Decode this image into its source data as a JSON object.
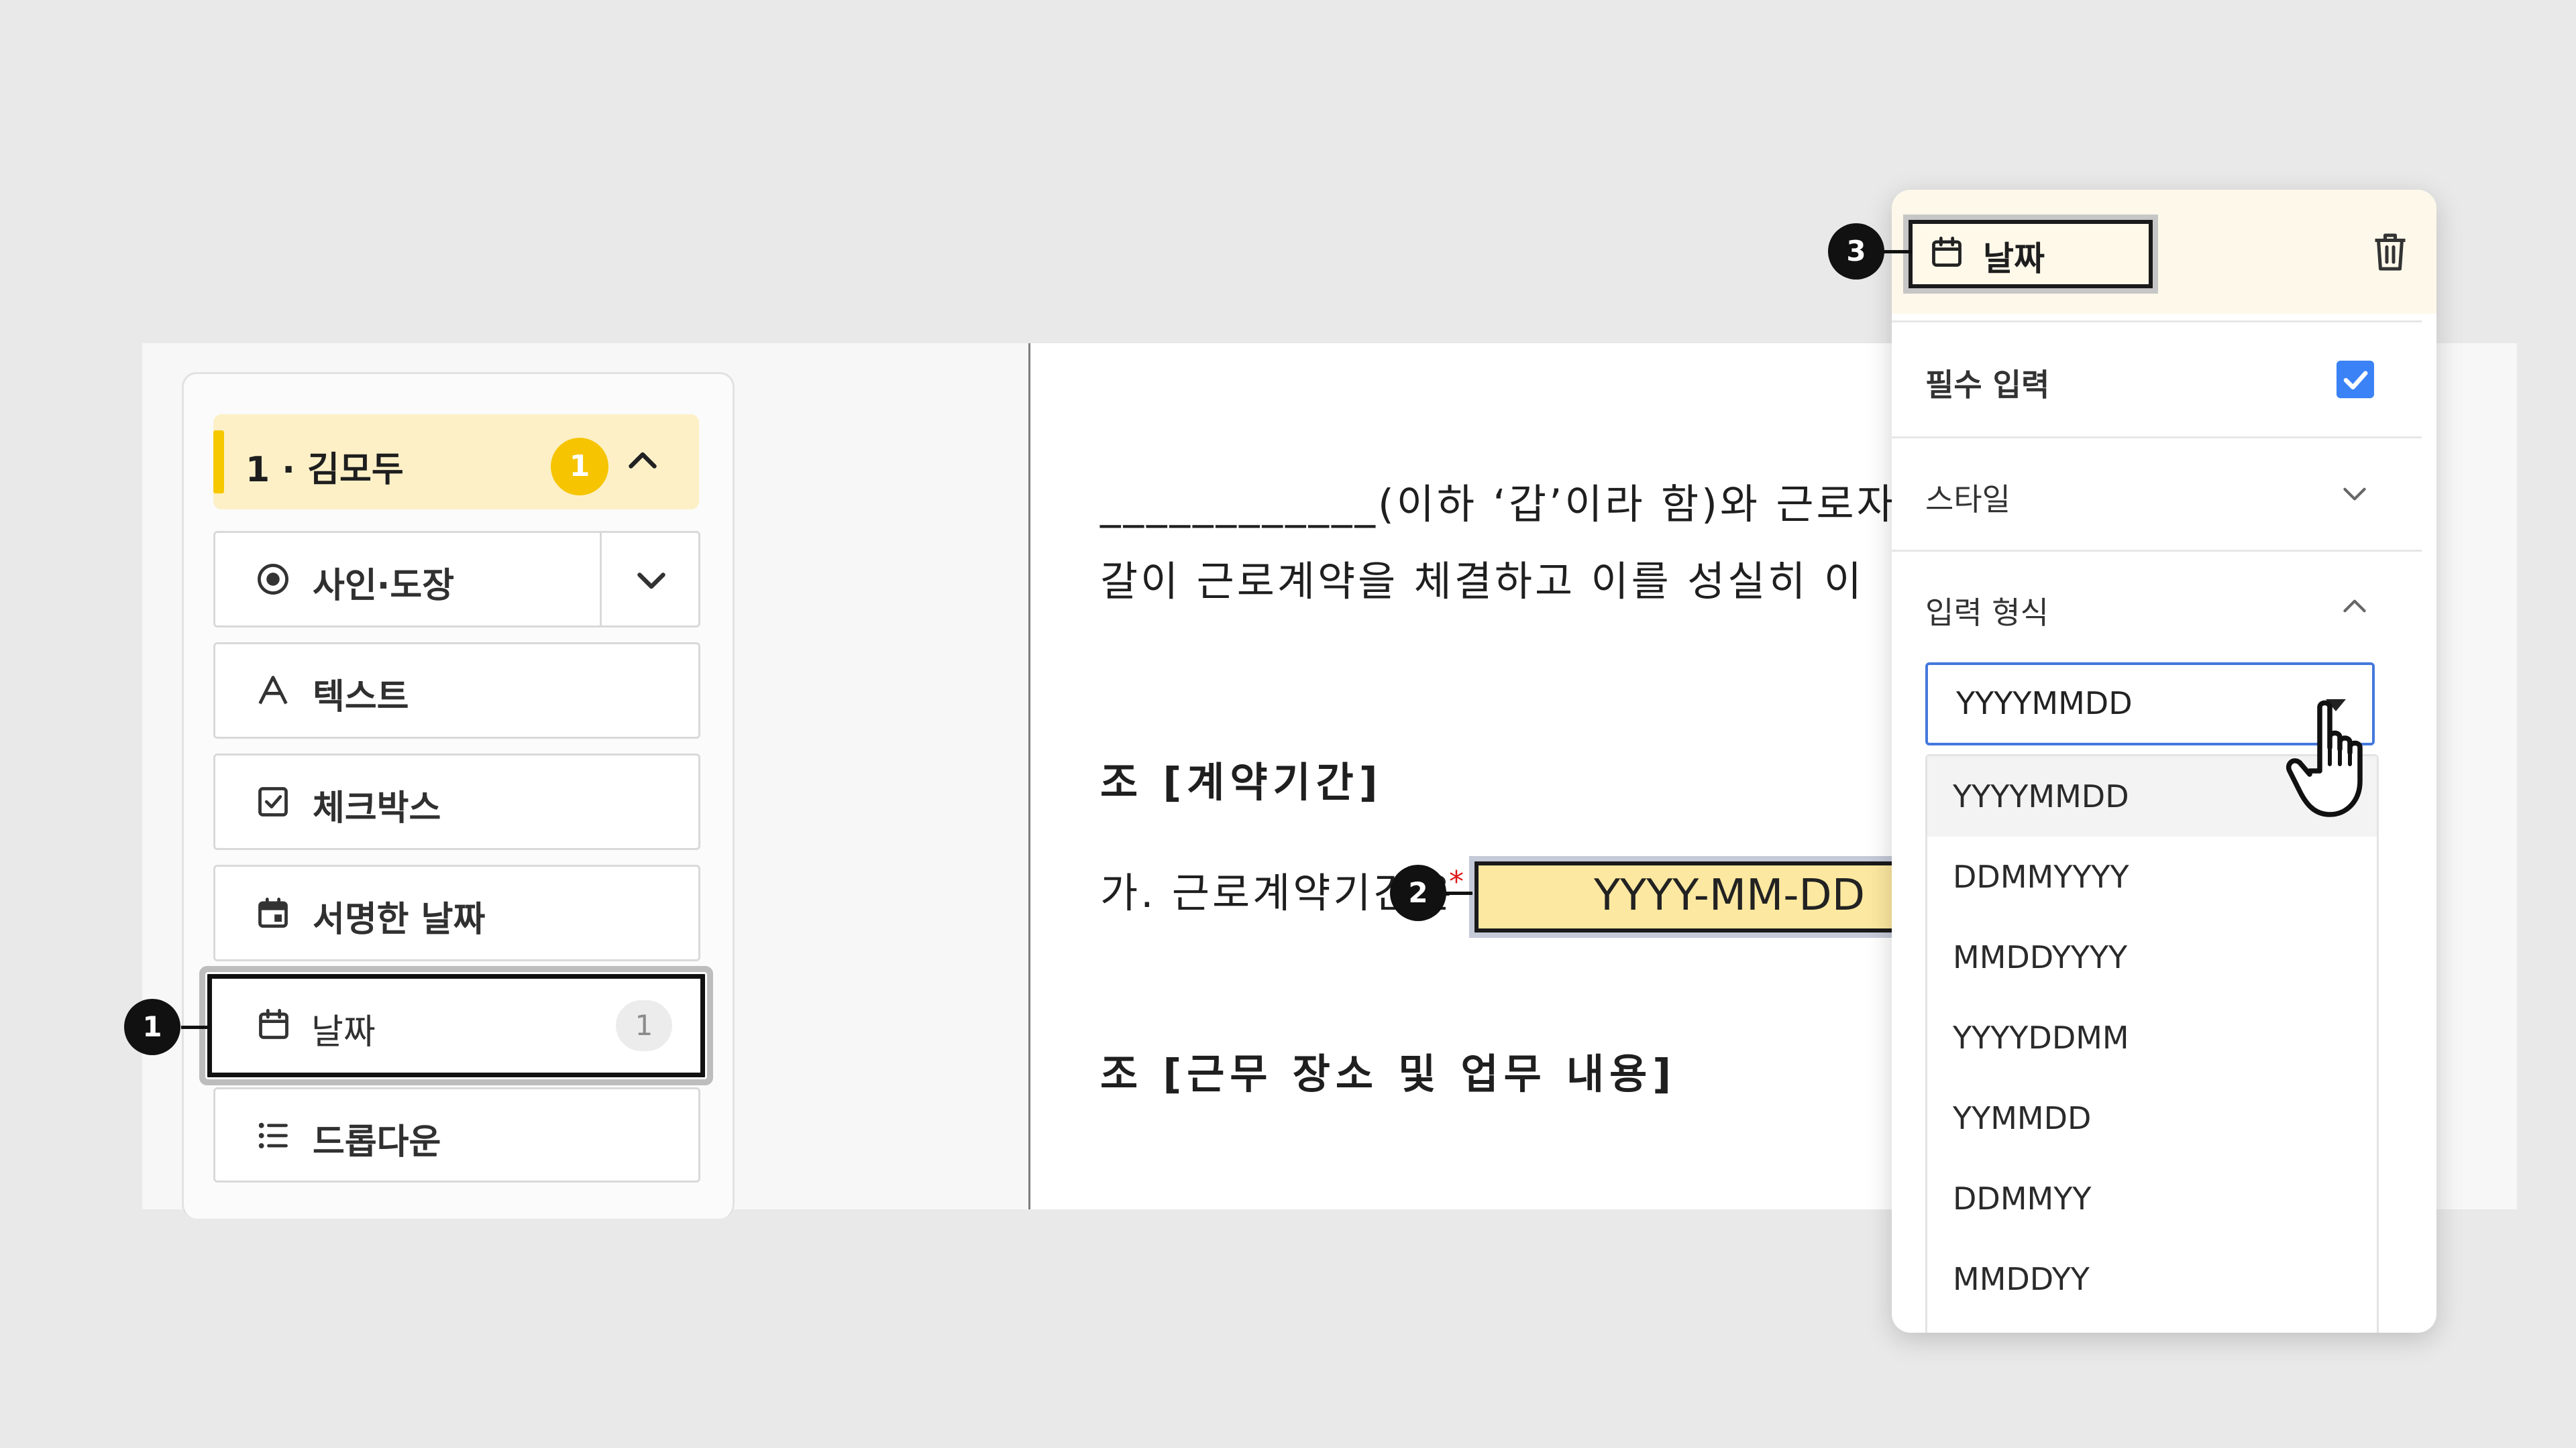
{
  "sidebar": {
    "signer": {
      "name": "1 · 김모두",
      "badge": "1"
    },
    "items": [
      {
        "label": "사인·도장",
        "icon": "radio-target-icon"
      },
      {
        "label": "텍스트",
        "icon": "text-a-icon"
      },
      {
        "label": "체크박스",
        "icon": "checkbox-icon"
      },
      {
        "label": "서명한 날짜",
        "icon": "calendar-filled-icon"
      },
      {
        "label": "날짜",
        "icon": "calendar-icon",
        "count": "1"
      },
      {
        "label": "드롭다운",
        "icon": "list-icon"
      }
    ]
  },
  "document": {
    "lines": [
      "____________(이하 ‘갑’이라 함)와 근로자",
      "갈이 근로계약을 체결하고 이를 성실히 이",
      "조 [계약기간]",
      "가. 근로계약기간은",
      "조 [근무 장소 및 업무 내용]"
    ],
    "date_field_placeholder": "YYYY-MM-DD",
    "required_mark": "*"
  },
  "callouts": [
    "1",
    "2",
    "3"
  ],
  "panel": {
    "field_type": "날짜",
    "required_label": "필수 입력",
    "required_checked": true,
    "style_label": "스타일",
    "format_label": "입력 형식",
    "selected_format": "YYYYMMDD",
    "format_options": [
      "YYYYMMDD",
      "DDMMYYYY",
      "MMDDYYYY",
      "YYYYDDMM",
      "YYMMDD",
      "DDMMYY",
      "MMDDYY"
    ]
  },
  "colors": {
    "accent_yellow": "#f6c400",
    "header_bg": "#fdf0c7",
    "checkbox_blue": "#3b82f6",
    "select_border": "#4478dc",
    "date_field_bg": "#fce8a0"
  }
}
